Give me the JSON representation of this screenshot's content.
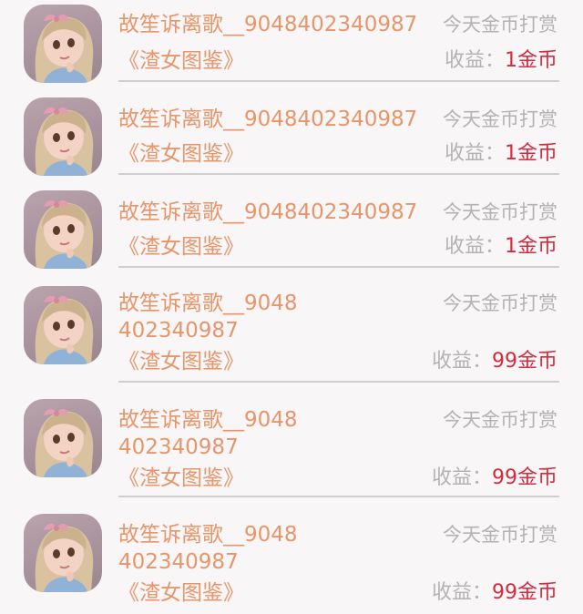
{
  "colors": {
    "name_text": "#e8956a",
    "muted_text": "#b3b3b3",
    "income_value": "#d52b3e",
    "background": "#f8f6f7",
    "divider": "#cfcfcf"
  },
  "rows": [
    {
      "name": "故笙诉离歌__9048402340987",
      "status": "今天金币打赏",
      "book": "《渣女图鉴》",
      "income_label": "收益：",
      "income_value": "1金币"
    },
    {
      "name": "故笙诉离歌__9048402340987",
      "status": "今天金币打赏",
      "book": "《渣女图鉴》",
      "income_label": "收益：",
      "income_value": "1金币"
    },
    {
      "name": "故笙诉离歌__9048402340987",
      "status": "今天金币打赏",
      "book": "《渣女图鉴》",
      "income_label": "收益：",
      "income_value": "1金币"
    },
    {
      "name": "故笙诉离歌__9048402340987",
      "status": "今天金币打赏",
      "book": "《渣女图鉴》",
      "income_label": "收益：",
      "income_value": "99金币"
    },
    {
      "name": "故笙诉离歌__9048402340987",
      "status": "今天金币打赏",
      "book": "《渣女图鉴》",
      "income_label": "收益：",
      "income_value": "99金币"
    },
    {
      "name": "故笙诉离歌__9048402340987",
      "status": "今天金币打赏",
      "book": "《渣女图鉴》",
      "income_label": "收益：",
      "income_value": "99金币"
    }
  ],
  "icons": {
    "avatar": "user-avatar-icon"
  }
}
